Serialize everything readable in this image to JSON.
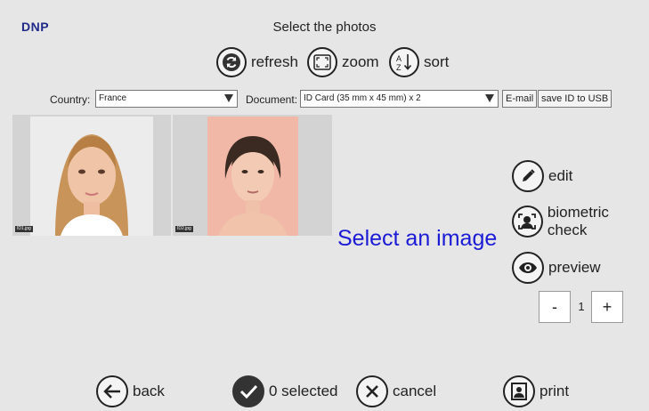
{
  "header": {
    "logo": "DNP",
    "title": "Select the photos"
  },
  "toolbar": {
    "refresh": "refresh",
    "zoom": "zoom",
    "sort": "sort"
  },
  "filters": {
    "country_label": "Country:",
    "country_value": "France",
    "document_label": "Document:",
    "document_value": "ID Card (35 mm x 45 mm) x 2",
    "email": "E-mail",
    "save_usb": "save ID to USB"
  },
  "photos": [
    {
      "filename": "ID1.jpg"
    },
    {
      "filename": "ID2.jpg"
    }
  ],
  "main": {
    "message": "Select an image"
  },
  "side": {
    "edit": "edit",
    "biometric": "biometric check",
    "preview": "preview"
  },
  "quantity": {
    "minus": "-",
    "value": "1",
    "plus": "+"
  },
  "bottom": {
    "back": "back",
    "selected": "0 selected",
    "cancel": "cancel",
    "print": "print"
  },
  "colors": {
    "logo": "#1f2a8a",
    "message": "#1b1bd6",
    "background": "#e6e6e6"
  }
}
